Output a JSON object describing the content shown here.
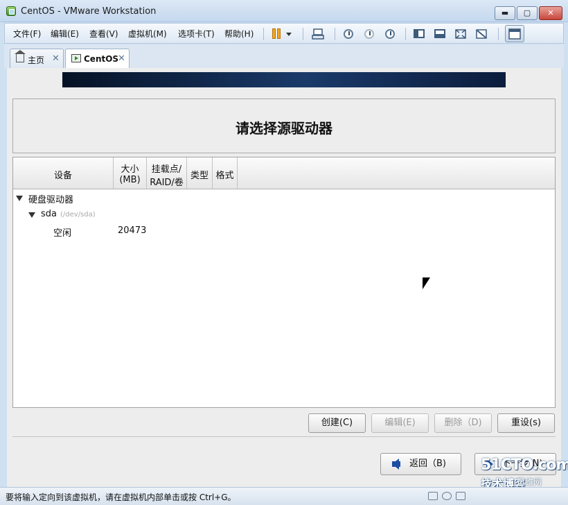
{
  "window": {
    "title": "CentOS - VMware Workstation",
    "controls": {
      "minimize": "▬",
      "maximize": "▢",
      "close": "✕"
    }
  },
  "menu": {
    "items": [
      "文件(F)",
      "编辑(E)",
      "查看(V)",
      "虚拟机(M)",
      "选项卡(T)",
      "帮助(H)"
    ]
  },
  "toolbar": {
    "icons": [
      "pause-icon",
      "dropdown-arrow-icon",
      "send-ctrl-alt-del-icon",
      "snapshot-take-icon",
      "snapshot-revert-icon",
      "snapshot-manager-icon",
      "show-sidebar-icon",
      "show-thumbnails-icon",
      "fullscreen-icon",
      "unity-icon",
      "console-view-icon"
    ],
    "accent": "#f1a51f"
  },
  "tabs": [
    {
      "label": "主页",
      "icon": "home-icon",
      "close": "✕"
    },
    {
      "label": "CentOS",
      "icon": "vm-icon",
      "close": "✕"
    }
  ],
  "installer": {
    "heading": "请选择源驱动器",
    "columns": [
      {
        "line1": "设备",
        "line2": ""
      },
      {
        "line1": "大小",
        "line2": "(MB)"
      },
      {
        "line1": "挂载点/",
        "line2": "RAID/卷"
      },
      {
        "line1": "类型",
        "line2": ""
      },
      {
        "line1": "格式",
        "line2": ""
      }
    ],
    "tree": {
      "group": "硬盘驱动器",
      "device": "sda",
      "device_path": "(/dev/sda)",
      "free_label": "空闲",
      "free_size": "20473"
    },
    "buttons": {
      "create": "创建(C)",
      "edit": "编辑(E)",
      "delete": "删除（D)",
      "reset": "重设(s)",
      "back": "返回（B)",
      "next": "下一步(N)"
    }
  },
  "watermark": {
    "main": "51CTO.com",
    "sub": "技术博客",
    "site": "运维网 iyunv.com"
  },
  "status": {
    "message": "要将输入定向到该虚拟机，请在虚拟机内部单击或按 Ctrl+G。"
  }
}
